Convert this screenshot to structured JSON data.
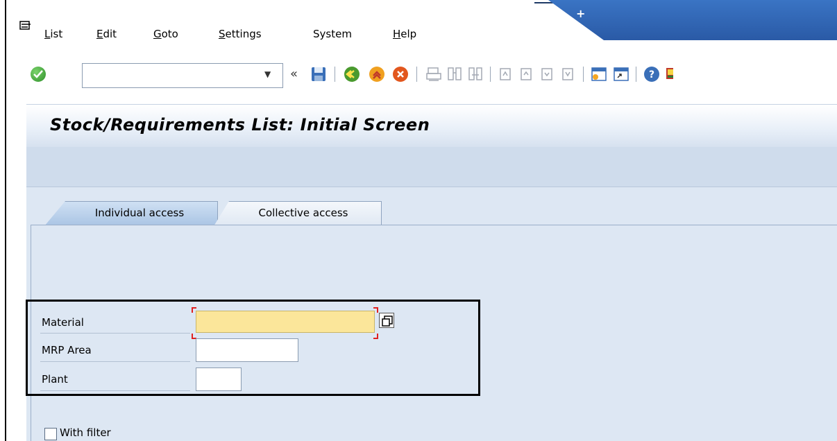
{
  "menu": {
    "items": [
      {
        "label": "List",
        "underline": "L",
        "rest": "ist"
      },
      {
        "label": "Edit",
        "underline": "E",
        "rest": "dit"
      },
      {
        "label": "Goto",
        "underline": "G",
        "rest": "oto"
      },
      {
        "label": "Settings",
        "underline": "S",
        "rest": "ettings"
      },
      {
        "label": "System",
        "underline": "",
        "rest": "System"
      },
      {
        "label": "Help",
        "underline": "H",
        "rest": "elp"
      }
    ],
    "title_mark": "+"
  },
  "toolbar": {
    "command_value": "",
    "back_chevron": "«",
    "icons": [
      "ok-icon",
      "save-icon",
      "back-icon",
      "exit-icon",
      "cancel-icon",
      "print-icon",
      "find-icon",
      "find-next-icon",
      "first-page-icon",
      "previous-page-icon",
      "next-page-icon",
      "last-page-icon",
      "create-session-icon",
      "shortcut-icon",
      "help-icon",
      "customize-layout-icon"
    ]
  },
  "header": {
    "title": "Stock/Requirements List: Initial Screen"
  },
  "tabs": [
    {
      "label": "Individual access",
      "active": true
    },
    {
      "label": "Collective access",
      "active": false
    }
  ],
  "fields": {
    "material": {
      "label": "Material",
      "value": ""
    },
    "mrp_area": {
      "label": "MRP Area",
      "value": ""
    },
    "plant": {
      "label": "Plant",
      "value": ""
    }
  },
  "filter": {
    "label": "With filter",
    "checked": false
  },
  "colors": {
    "accent": "#2a5aa6",
    "required_field": "#fbe69a",
    "panel_bg": "#dde7f3"
  }
}
